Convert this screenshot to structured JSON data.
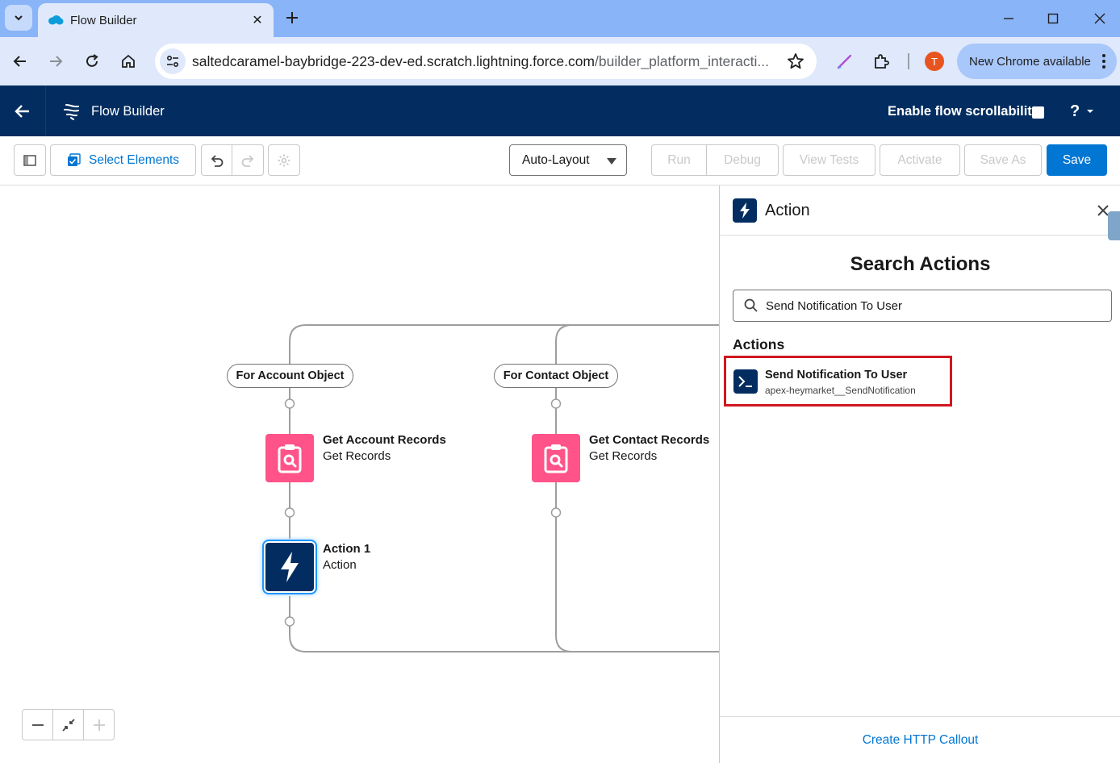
{
  "browser": {
    "tab_title": "Flow Builder",
    "url_host": "saltedcaramel-baybridge-223-dev-ed.scratch.lightning.force.com",
    "url_path": "/builder_platform_interacti...",
    "update_label": "New Chrome available",
    "avatar_letter": "T"
  },
  "header": {
    "app_title": "Flow Builder",
    "scroll_label": "Enable flow scrollability",
    "help_label": "?"
  },
  "toolbar": {
    "select_elements": "Select Elements",
    "layout_value": "Auto-Layout",
    "run": "Run",
    "debug": "Debug",
    "view_tests": "View Tests",
    "activate": "Activate",
    "save_as": "Save As",
    "save": "Save"
  },
  "canvas": {
    "branch_account": "For Account Object",
    "branch_contact": "For Contact Object",
    "nodes": [
      {
        "title": "Get Account Records",
        "subtitle": "Get Records"
      },
      {
        "title": "Get Contact Records",
        "subtitle": "Get Records"
      },
      {
        "title": "Action 1",
        "subtitle": "Action"
      }
    ]
  },
  "panel": {
    "title": "Action",
    "heading": "Search Actions",
    "search_value": "Send Notification To User",
    "section_label": "Actions",
    "result_title": "Send Notification To User",
    "result_subtitle": "apex-heymarket__SendNotification",
    "footer_link": "Create HTTP Callout"
  },
  "colors": {
    "sf_navy": "#032d60",
    "sf_blue": "#0176d3",
    "records_pink": "#ff538a",
    "highlight_red": "#d0171e"
  }
}
